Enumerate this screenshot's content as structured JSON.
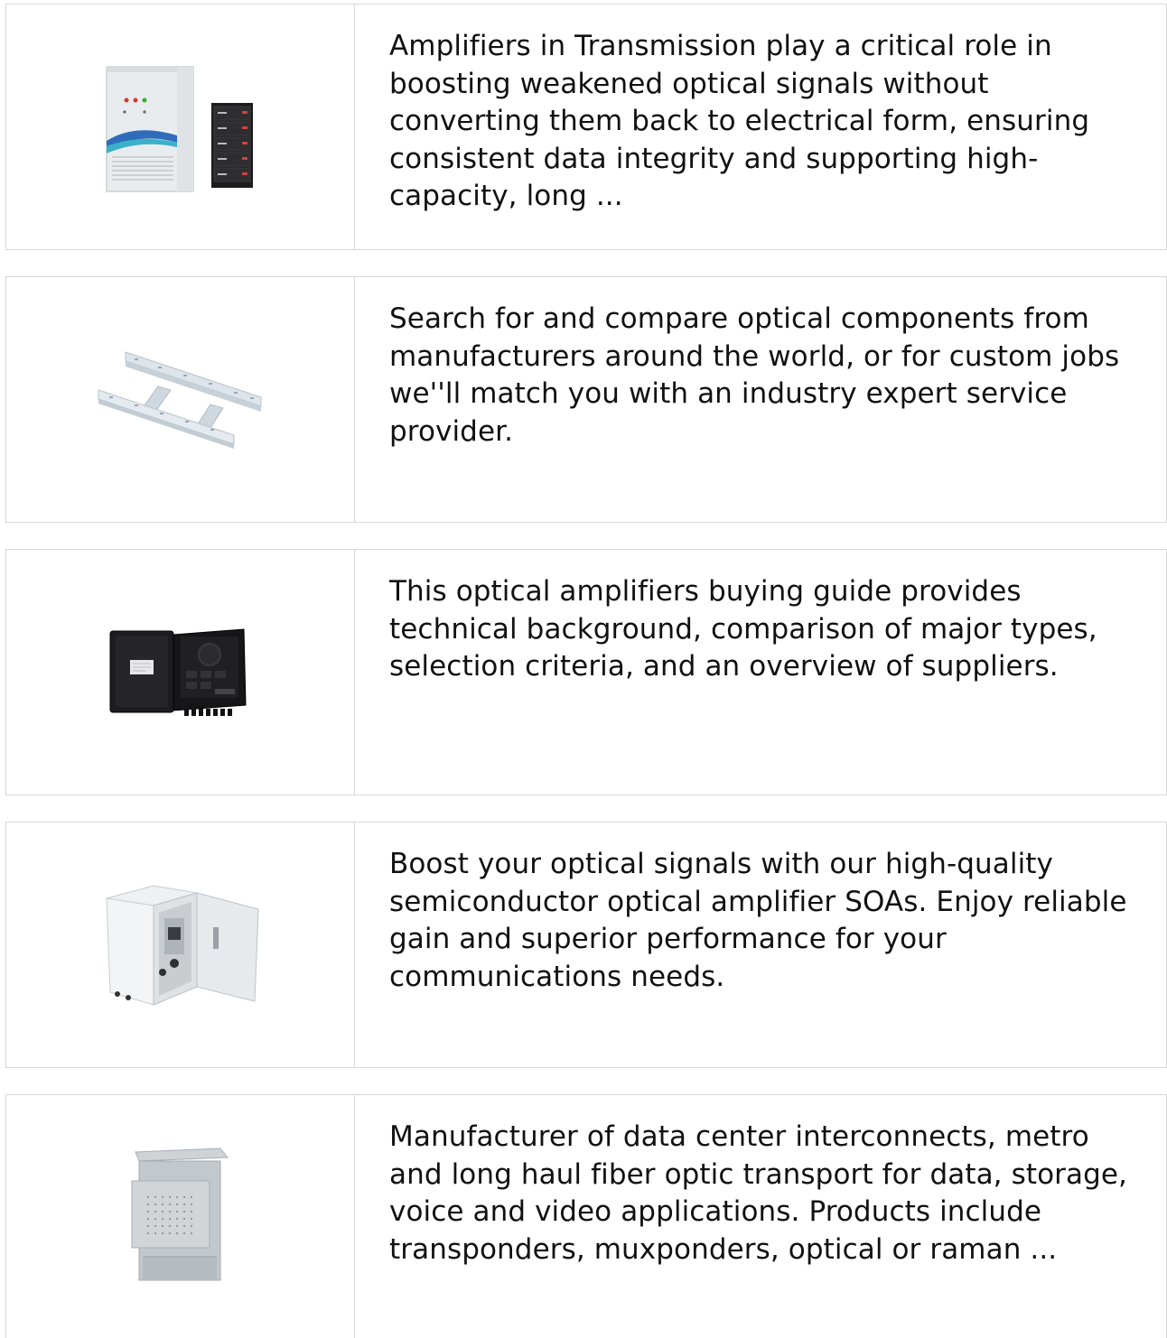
{
  "items": [
    {
      "image": "outdoor-cabinet-with-battery-pack",
      "text": "Amplifiers in Transmission play a critical role in boosting weakened optical signals without converting them back to electrical form, ensuring consistent data integrity and supporting high-capacity, long ..."
    },
    {
      "image": "aluminum-cable-ladder-tray",
      "text": "Search for and compare optical components from manufacturers around the world, or for custom jobs we''ll match you with an industry expert service provider."
    },
    {
      "image": "black-fiber-distribution-box-open",
      "text": "This optical amplifiers buying guide provides technical background, comparison of major types, selection criteria, and an overview of suppliers."
    },
    {
      "image": "open-outdoor-enclosure-cabinet",
      "text": "Boost your optical signals with our high-quality semiconductor optical amplifier SOAs. Enjoy reliable gain and superior performance for your communications needs."
    },
    {
      "image": "grey-outdoor-cabinet-vented",
      "text": "Manufacturer of data center interconnects, metro and long haul fiber optic transport for data, storage, voice and video applications. Products include transponders, muxponders, optical or raman ..."
    }
  ]
}
